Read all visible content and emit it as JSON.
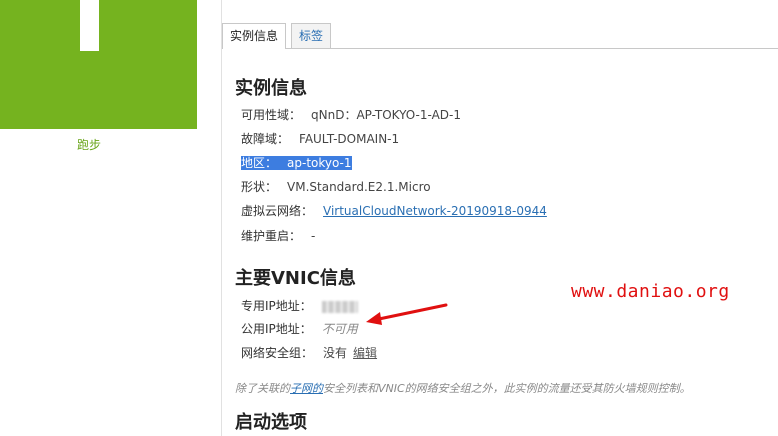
{
  "status": {
    "label": "跑步",
    "color": "#75b31f"
  },
  "tabs": [
    {
      "label": "实例信息",
      "active": true
    },
    {
      "label": "标签",
      "active": false
    }
  ],
  "instance_info": {
    "title": "实例信息",
    "rows": [
      {
        "label": "可用性域：",
        "value": "qNnD：AP-TOKYO-1-AD-1"
      },
      {
        "label": "故障域：",
        "value": "FAULT-DOMAIN-1"
      },
      {
        "label": "地区：",
        "value": "ap-tokyo-1"
      },
      {
        "label": "形状：",
        "value": "VM.Standard.E2.1.Micro"
      },
      {
        "label": "虚拟云网络：",
        "value": "VirtualCloudNetwork-20190918-0944"
      },
      {
        "label": "维护重启：",
        "value": "-"
      }
    ]
  },
  "vnic": {
    "title": "主要VNIC信息",
    "private_ip_label": "专用IP地址：",
    "public_ip_label": "公用IP地址：",
    "public_ip_value": "不可用",
    "nsg_label": "网络安全组：",
    "nsg_value": "没有",
    "edit_label": "编辑"
  },
  "note": {
    "prefix": "除了关联的",
    "link": "子网的",
    "suffix": "安全列表和VNIC的网络安全组之外，此实例的流量还受其防火墙规则控制。"
  },
  "launch": {
    "title": "启动选项"
  },
  "watermark": "www.daniao.org",
  "colors": {
    "accent_link": "#2a6fb3",
    "selection": "#3d7de0",
    "annotation_red": "#e01010"
  }
}
